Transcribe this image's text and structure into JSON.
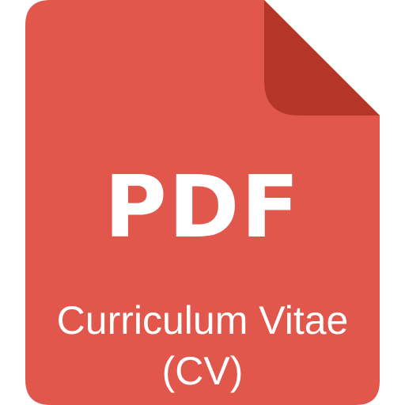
{
  "icon": {
    "name": "pdf-file-icon",
    "file_type_label": "PDF",
    "title_line1": "Curriculum Vitae",
    "title_line2": "(CV)",
    "colors": {
      "body": "#e2574c",
      "fold": "#b53629",
      "text": "#ffffff"
    }
  }
}
